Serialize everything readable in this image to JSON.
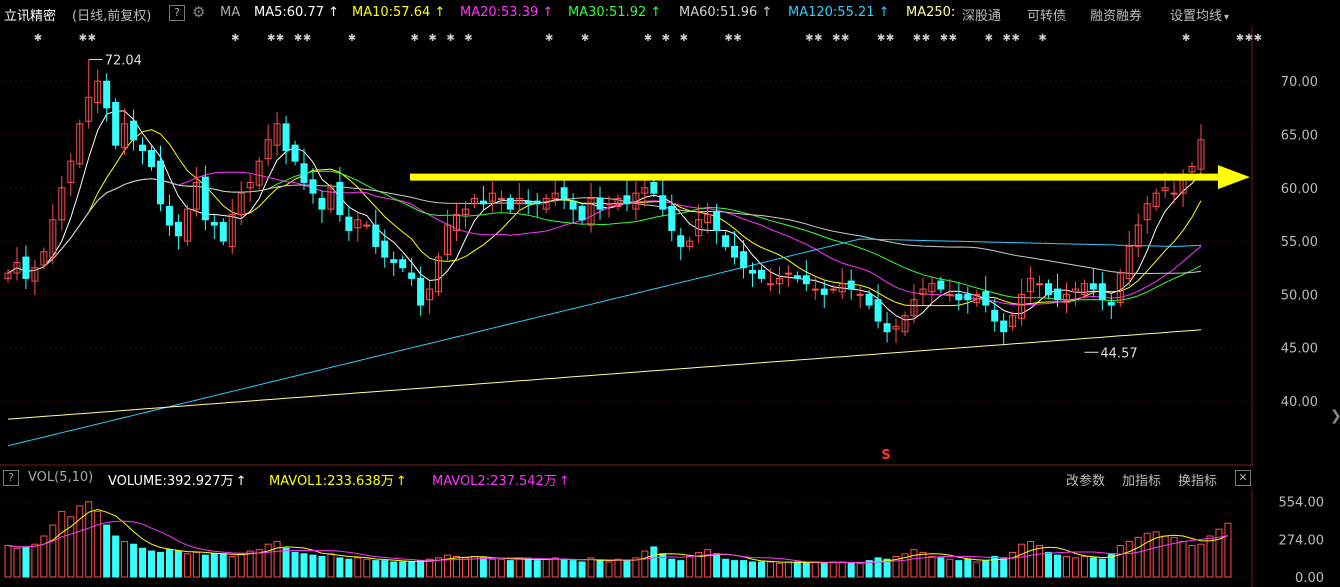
{
  "header": {
    "stock_name": "立讯精密",
    "mode": "(日线,前复权)",
    "help": "?",
    "ma_label": "MA",
    "ma_items": [
      {
        "text": "MA5:60.77",
        "color": "#ffffff"
      },
      {
        "text": "MA10:57.64",
        "color": "#ffff00"
      },
      {
        "text": "MA20:53.39",
        "color": "#ff33ff"
      },
      {
        "text": "MA30:51.92",
        "color": "#33ff33"
      },
      {
        "text": "MA60:51.96",
        "color": "#d0d0d0"
      },
      {
        "text": "MA120:55.21",
        "color": "#33ccff"
      },
      {
        "text": "MA250:",
        "color": "#ffff99"
      }
    ],
    "up_arrow": "↑",
    "links": [
      "深股通",
      "可转债",
      "融资融券",
      "设置均线"
    ],
    "dropdown_arrow": "▾"
  },
  "volume_header": {
    "help": "?",
    "title": "VOL(5,10)",
    "volume": "VOLUME:392.927万",
    "mavol1": "MAVOL1:233.638万",
    "mavol2": "MAVOL2:237.542万",
    "buttons": [
      "改参数",
      "加指标",
      "换指标"
    ],
    "close": "✕"
  },
  "colors": {
    "up": "#ff4d4d",
    "down": "#33ffff",
    "arrow": "#ffff00",
    "ma5": "#ffffff",
    "ma10": "#ffff00",
    "ma20": "#ff33ff",
    "ma30": "#33ff33",
    "ma60": "#c8c8c8",
    "ma120": "#33ccff",
    "ma250": "#ffff99"
  },
  "annotations": {
    "high_label": "72.04",
    "low_label": "44.57",
    "marker": "S"
  },
  "chart_data": [
    {
      "type": "candlestick",
      "y_ticks": [
        "70.00",
        "65.00",
        "60.00",
        "55.00",
        "50.00",
        "45.00",
        "40.00"
      ],
      "ylim": [
        35,
        74
      ],
      "grid": true,
      "price_high": 72.04,
      "price_low": 44.57,
      "resistance_arrow_level": 61.0,
      "close_path": [
        52.0,
        53.0,
        51.5,
        52.5,
        54.0,
        57.0,
        60.0,
        62.5,
        66.0,
        68.5,
        70.0,
        67.5,
        64.0,
        66.0,
        64.5,
        63.5,
        62.0,
        58.5,
        56.5,
        55.5,
        58.0,
        60.5,
        57.0,
        56.5,
        55.0,
        57.5,
        59.5,
        60.5,
        62.5,
        64.5,
        66.0,
        63.5,
        62.5,
        60.5,
        59.5,
        58.0,
        60.0,
        57.5,
        56.0,
        57.0,
        56.5,
        54.5,
        53.5,
        53.0,
        52.5,
        51.5,
        49.0,
        50.5,
        53.5,
        56.5,
        57.5,
        58.0,
        59.0,
        58.5,
        59.5,
        59.0,
        58.0,
        59.0,
        58.5,
        58.5,
        59.0,
        59.5,
        59.0,
        58.0,
        57.0,
        59.0,
        58.0,
        58.5,
        59.0,
        58.5,
        59.5,
        60.0,
        59.5,
        58.0,
        56.0,
        54.5,
        55.0,
        57.0,
        57.5,
        56.0,
        54.5,
        53.5,
        52.5,
        52.0,
        51.5,
        51.0,
        51.5,
        52.0,
        51.5,
        51.0,
        50.5,
        50.0,
        50.5,
        51.0,
        50.5,
        50.0,
        49.0,
        47.5,
        46.5,
        47.0,
        48.0,
        49.5,
        50.5,
        51.0,
        50.5,
        50.0,
        49.5,
        49.5,
        50.0,
        49.0,
        47.5,
        46.5,
        48.0,
        50.0,
        51.5,
        51.0,
        50.0,
        49.5,
        50.0,
        50.5,
        51.0,
        50.5,
        49.5,
        49.0,
        52.0,
        54.5,
        56.5,
        58.5,
        59.5,
        60.0,
        59.5,
        61.0,
        62.0,
        64.5
      ],
      "ma_values": {
        "MA5": 60.77,
        "MA10": 57.64,
        "MA20": 53.39,
        "MA30": 51.92,
        "MA60": 51.96,
        "MA120": 55.21
      }
    },
    {
      "type": "bar",
      "title": "VOL(5,10)",
      "y_ticks": [
        "554.00",
        "274.00",
        "0.00"
      ],
      "ylim": [
        0,
        600
      ],
      "unit": "万",
      "values": [
        230,
        210,
        220,
        240,
        300,
        380,
        480,
        440,
        520,
        550,
        480,
        380,
        300,
        260,
        240,
        210,
        190,
        180,
        200,
        190,
        170,
        180,
        160,
        170,
        170,
        150,
        170,
        190,
        200,
        240,
        260,
        210,
        180,
        170,
        160,
        150,
        170,
        140,
        130,
        140,
        130,
        120,
        120,
        110,
        110,
        110,
        120,
        130,
        140,
        160,
        150,
        140,
        150,
        140,
        130,
        130,
        120,
        140,
        130,
        120,
        130,
        140,
        130,
        120,
        110,
        140,
        120,
        110,
        130,
        120,
        140,
        190,
        220,
        170,
        130,
        120,
        150,
        180,
        200,
        170,
        130,
        120,
        120,
        110,
        110,
        110,
        100,
        110,
        110,
        100,
        110,
        100,
        110,
        110,
        100,
        100,
        120,
        140,
        130,
        150,
        170,
        200,
        180,
        150,
        140,
        130,
        120,
        130,
        110,
        120,
        150,
        140,
        180,
        240,
        260,
        230,
        180,
        160,
        150,
        140,
        150,
        140,
        130,
        170,
        230,
        260,
        290,
        320,
        330,
        300,
        290,
        260,
        230,
        240,
        300,
        350,
        393
      ],
      "mavol1_last": 233.638,
      "mavol2_last": 237.542
    }
  ]
}
